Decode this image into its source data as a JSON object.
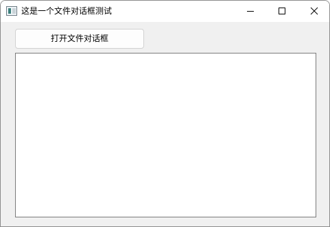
{
  "window": {
    "title": "这是一个文件对话框测试",
    "icon": "app-window-icon",
    "controls": {
      "minimize_icon": "minimize-icon",
      "maximize_icon": "maximize-icon",
      "close_icon": "close-icon"
    }
  },
  "toolbar": {
    "open_file_dialog_label": "打开文件对话框"
  },
  "content": {
    "text_area_value": ""
  },
  "colors": {
    "window_bg": "#f0f0f0",
    "titlebar_bg": "#ffffff",
    "button_bg": "#fdfdfd",
    "text_area_bg": "#ffffff",
    "text_area_border": "#7a7a7a"
  }
}
